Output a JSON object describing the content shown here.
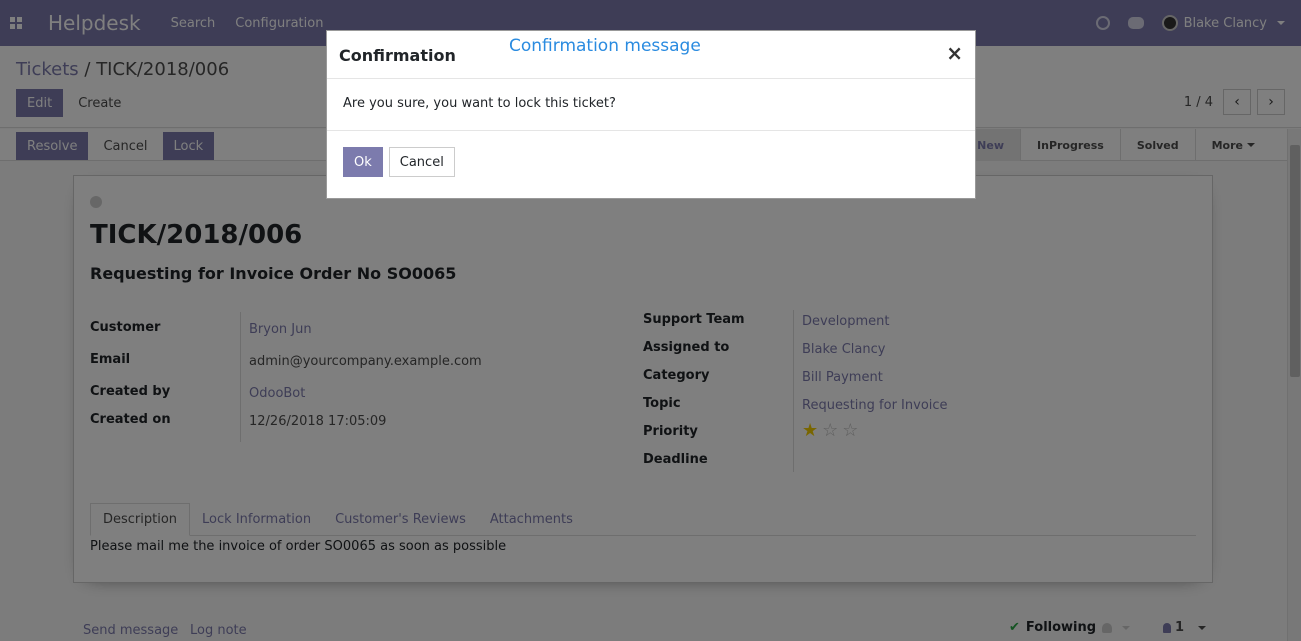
{
  "navbar": {
    "brand": "Helpdesk",
    "menu": [
      "Search",
      "Configuration"
    ],
    "user_name": "Blake Clancy",
    "icons": [
      "apps-icon",
      "clock-icon",
      "chat-icon",
      "avatar",
      "chevron-down-icon"
    ]
  },
  "breadcrumb": {
    "parent": "Tickets",
    "separator": "/",
    "current": "TICK/2018/006"
  },
  "control_buttons": {
    "edit": "Edit",
    "create": "Create"
  },
  "pager": {
    "value": "1 / 4",
    "prev": "‹",
    "next": "›"
  },
  "status_buttons": {
    "resolve": "Resolve",
    "cancel": "Cancel",
    "lock": "Lock"
  },
  "stages": [
    {
      "label": "New",
      "active": true
    },
    {
      "label": "InProgress",
      "active": false
    },
    {
      "label": "Solved",
      "active": false
    },
    {
      "label": "More",
      "active": false
    }
  ],
  "ticket": {
    "name": "TICK/2018/006",
    "subject": "Requesting for Invoice Order No SO0065",
    "left_fields": [
      {
        "label": "Customer",
        "value": "Bryon Jun"
      },
      {
        "label": "Email",
        "value": "admin@yourcompany.example.com"
      },
      {
        "label": "Created by",
        "value": "OdooBot"
      },
      {
        "label": "Created on",
        "value": "12/26/2018 17:05:09"
      }
    ],
    "right_fields": [
      {
        "label": "Support Team",
        "value": "Development"
      },
      {
        "label": "Assigned to",
        "value": "Blake Clancy"
      },
      {
        "label": "Category",
        "value": "Bill Payment"
      },
      {
        "label": "Topic",
        "value": "Requesting for Invoice"
      },
      {
        "label": "Priority",
        "value": ""
      },
      {
        "label": "Deadline",
        "value": ""
      }
    ],
    "priority_stars": {
      "filled": 1,
      "total": 3
    },
    "tabs": [
      "Description",
      "Lock Information",
      "Customer's Reviews",
      "Attachments"
    ],
    "description": "Please mail me the invoice of order SO0065 as soon as possible"
  },
  "chatter": {
    "send_message": "Send message",
    "log_note": "Log note",
    "following": "Following",
    "followers_count": "1"
  },
  "modal": {
    "title": "Confirmation",
    "annotation": "Confirmation message",
    "close": "×",
    "body": "Are you sure, you want to lock this ticket?",
    "ok": "Ok",
    "cancel": "Cancel"
  }
}
